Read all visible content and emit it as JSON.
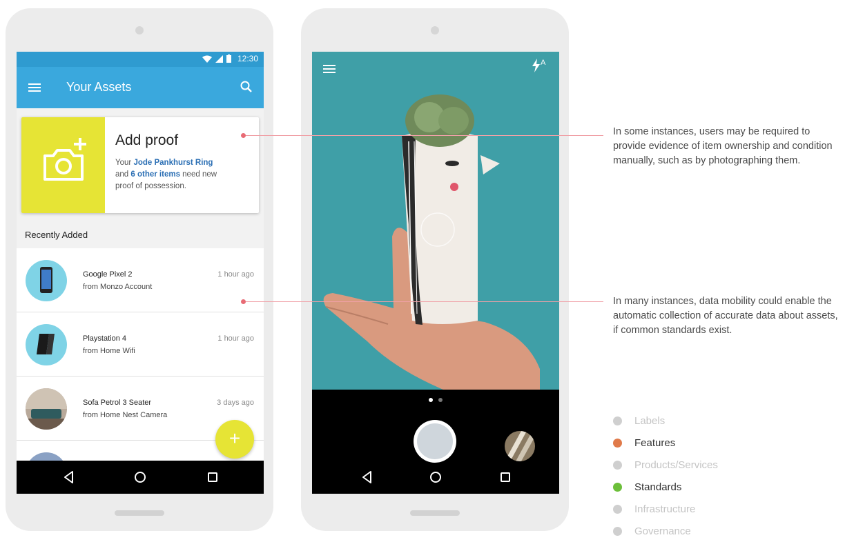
{
  "phone1": {
    "status_time": "12:30",
    "app_title": "Your Assets",
    "proof_card": {
      "heading": "Add proof",
      "line1_prefix": "Your ",
      "line1_link": "Jode Pankhurst Ring",
      "line2_prefix": "and ",
      "line2_link": "6 other items",
      "line2_suffix": " need new",
      "line3": "proof of possession."
    },
    "section_label": "Recently Added",
    "items": [
      {
        "name": "Google Pixel 2",
        "source": "from Monzo Account",
        "time": "1 hour ago"
      },
      {
        "name": "Playstation 4",
        "source": "from Home Wifi",
        "time": "1 hour ago"
      },
      {
        "name": "Sofa Petrol 3 Seater",
        "source": "from Home Nest Camera",
        "time": "3 days ago"
      }
    ],
    "fab_label": "+"
  },
  "phone2": {
    "flash_label": "A"
  },
  "annotations": {
    "top": "In some instances, users may be required to provide evidence of item ownership and condition manually, such as by photographing them.",
    "bottom": "In many instances, data mobility could enable the automatic collection of accurate data about assets, if common standards exist."
  },
  "legend": [
    {
      "label": "Labels",
      "color": "#cfcfcf",
      "active": false
    },
    {
      "label": "Features",
      "color": "#e07a4a",
      "active": true
    },
    {
      "label": "Products/Services",
      "color": "#cfcfcf",
      "active": false
    },
    {
      "label": "Standards",
      "color": "#6cbf3a",
      "active": true
    },
    {
      "label": "Infrastructure",
      "color": "#cfcfcf",
      "active": false
    },
    {
      "label": "Governance",
      "color": "#cfcfcf",
      "active": false
    }
  ],
  "colors": {
    "appbar": "#3aa8dd",
    "accent_yellow": "#e6e435",
    "annotation": "#e86b75"
  }
}
